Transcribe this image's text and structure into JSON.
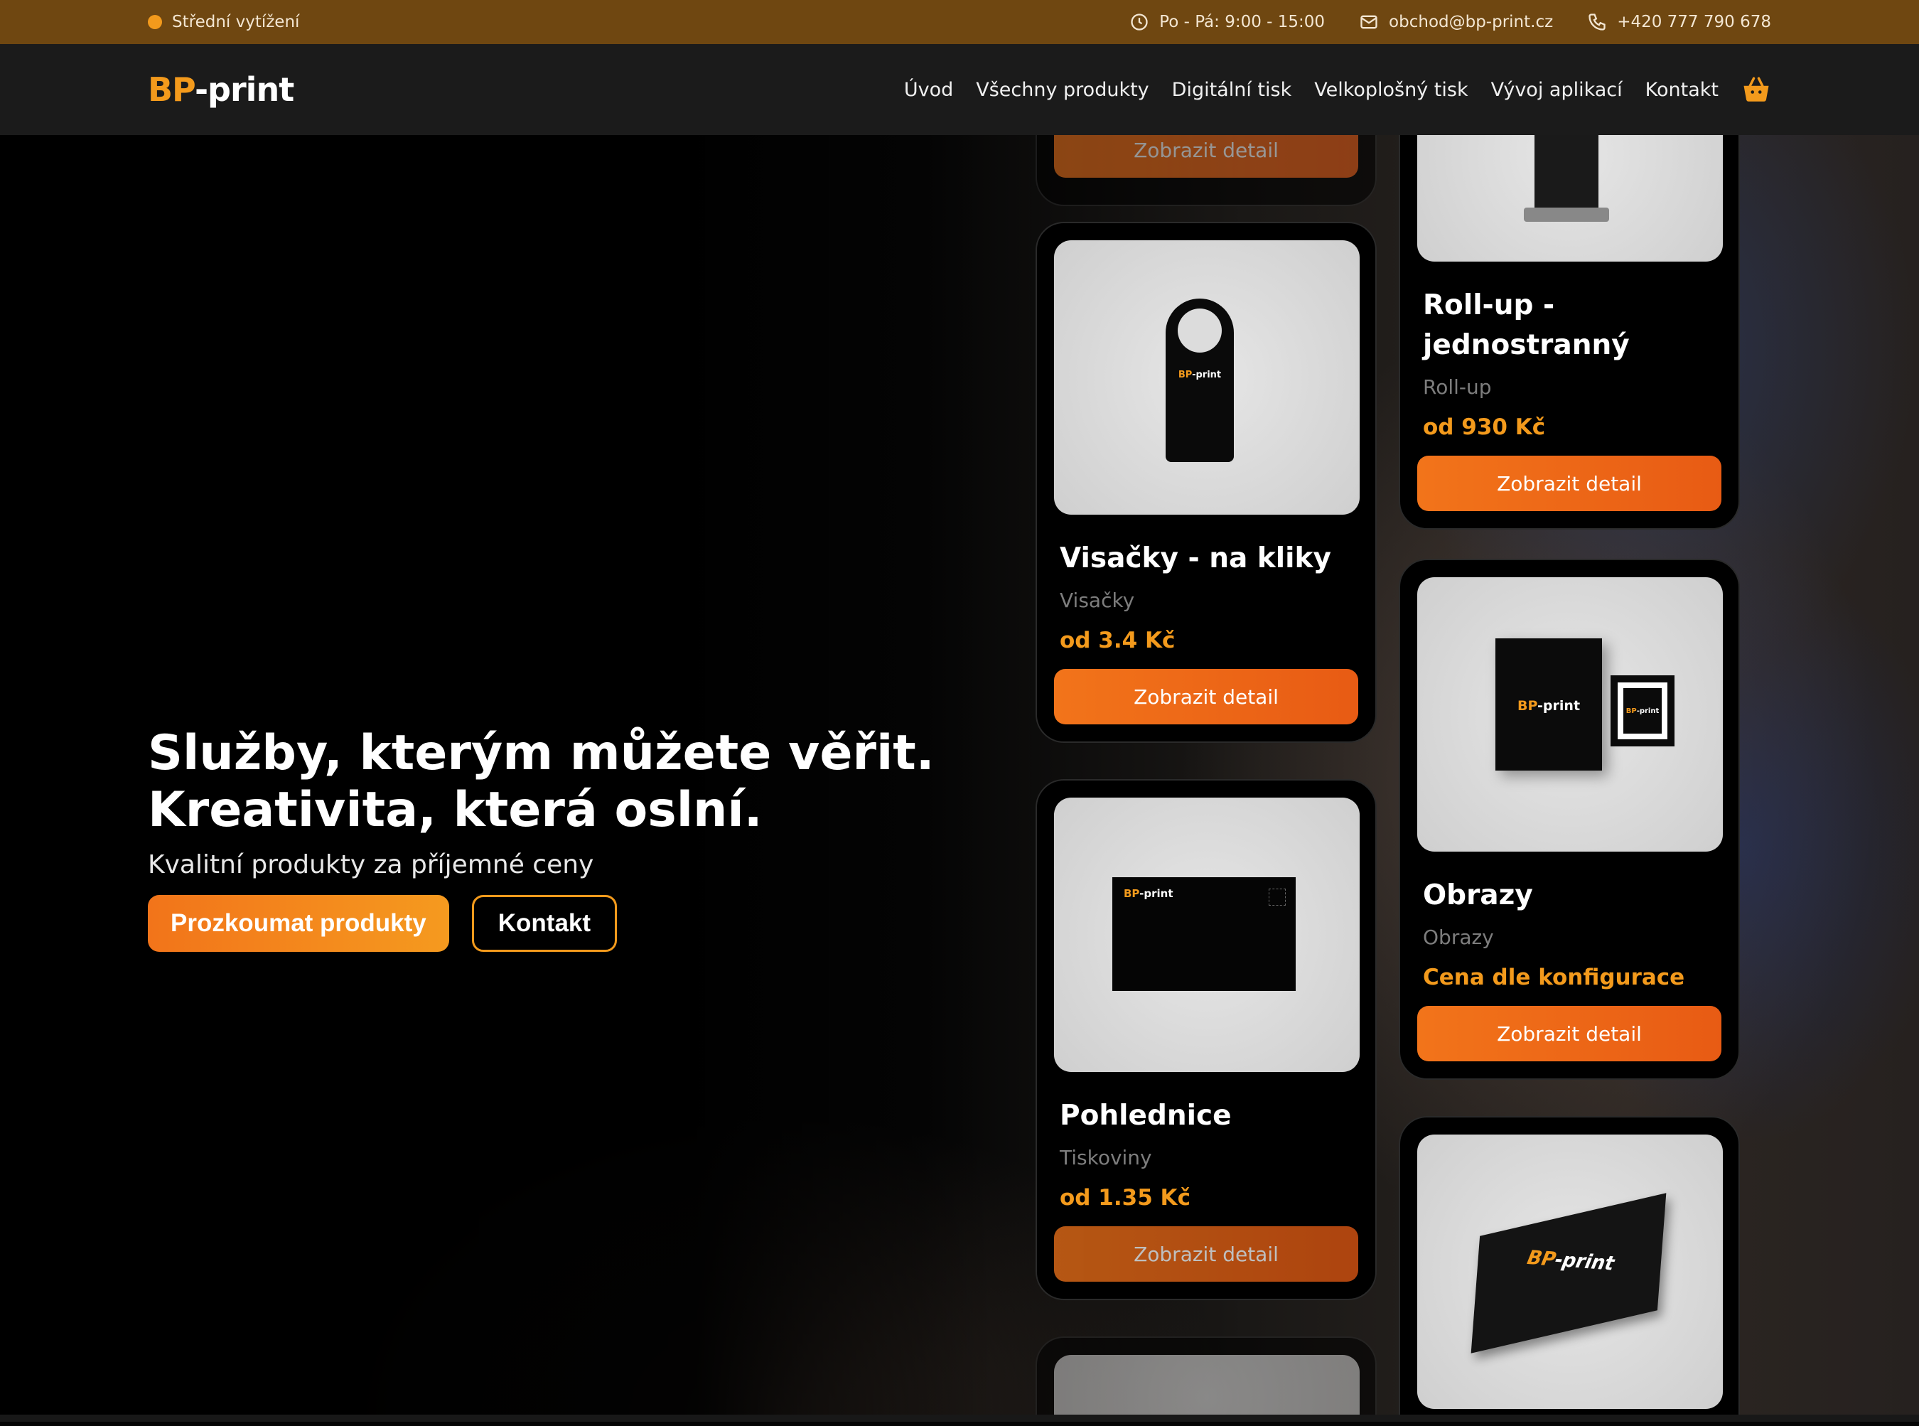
{
  "topbar": {
    "status_label": "Střední vytížení",
    "hours": "Po - Pá: 9:00 - 15:00",
    "email": "obchod@bp-print.cz",
    "phone": "+420 777 790 678"
  },
  "header": {
    "logo_accent": "BP",
    "logo_rest": "-print",
    "nav": [
      "Úvod",
      "Všechny produkty",
      "Digitální tisk",
      "Velkoplošný tisk",
      "Vývoj aplikací",
      "Kontakt"
    ]
  },
  "hero": {
    "title_line1": "Služby, kterým můžete věřit.",
    "title_line2": "Kreativita, která oslní.",
    "subtitle": "Kvalitní produkty za příjemné ceny",
    "primary_button": "Prozkoumat produkty",
    "secondary_button": "Kontakt"
  },
  "products": {
    "detail_label": "Zobrazit detail",
    "items": [
      {
        "name": "Visačky - na kliky",
        "category": "Visačky",
        "price": "od 3.4 Kč",
        "image_label_accent": "BP",
        "image_label_rest": "-print"
      },
      {
        "name": "Pohlednice",
        "category": "Tiskoviny",
        "price": "od 1.35 Kč",
        "image_label_accent": "BP",
        "image_label_rest": "-print"
      },
      {
        "name": "Roll-up - jednostranný",
        "category": "Roll-up",
        "price": "od 930 Kč"
      },
      {
        "name": "Obrazy",
        "category": "Obrazy",
        "price": "Cena dle konfigurace",
        "image_label_accent": "BP",
        "image_label_rest": "-print"
      },
      {
        "name": "",
        "category": "",
        "price": "",
        "image_label_accent": "BP",
        "image_label_rest": "-print"
      }
    ]
  },
  "colors": {
    "accent": "#f39a1c",
    "topbar_bg": "#6f4711",
    "header_bg": "#1b1b1b",
    "button_gradient_start": "#f2741a"
  }
}
